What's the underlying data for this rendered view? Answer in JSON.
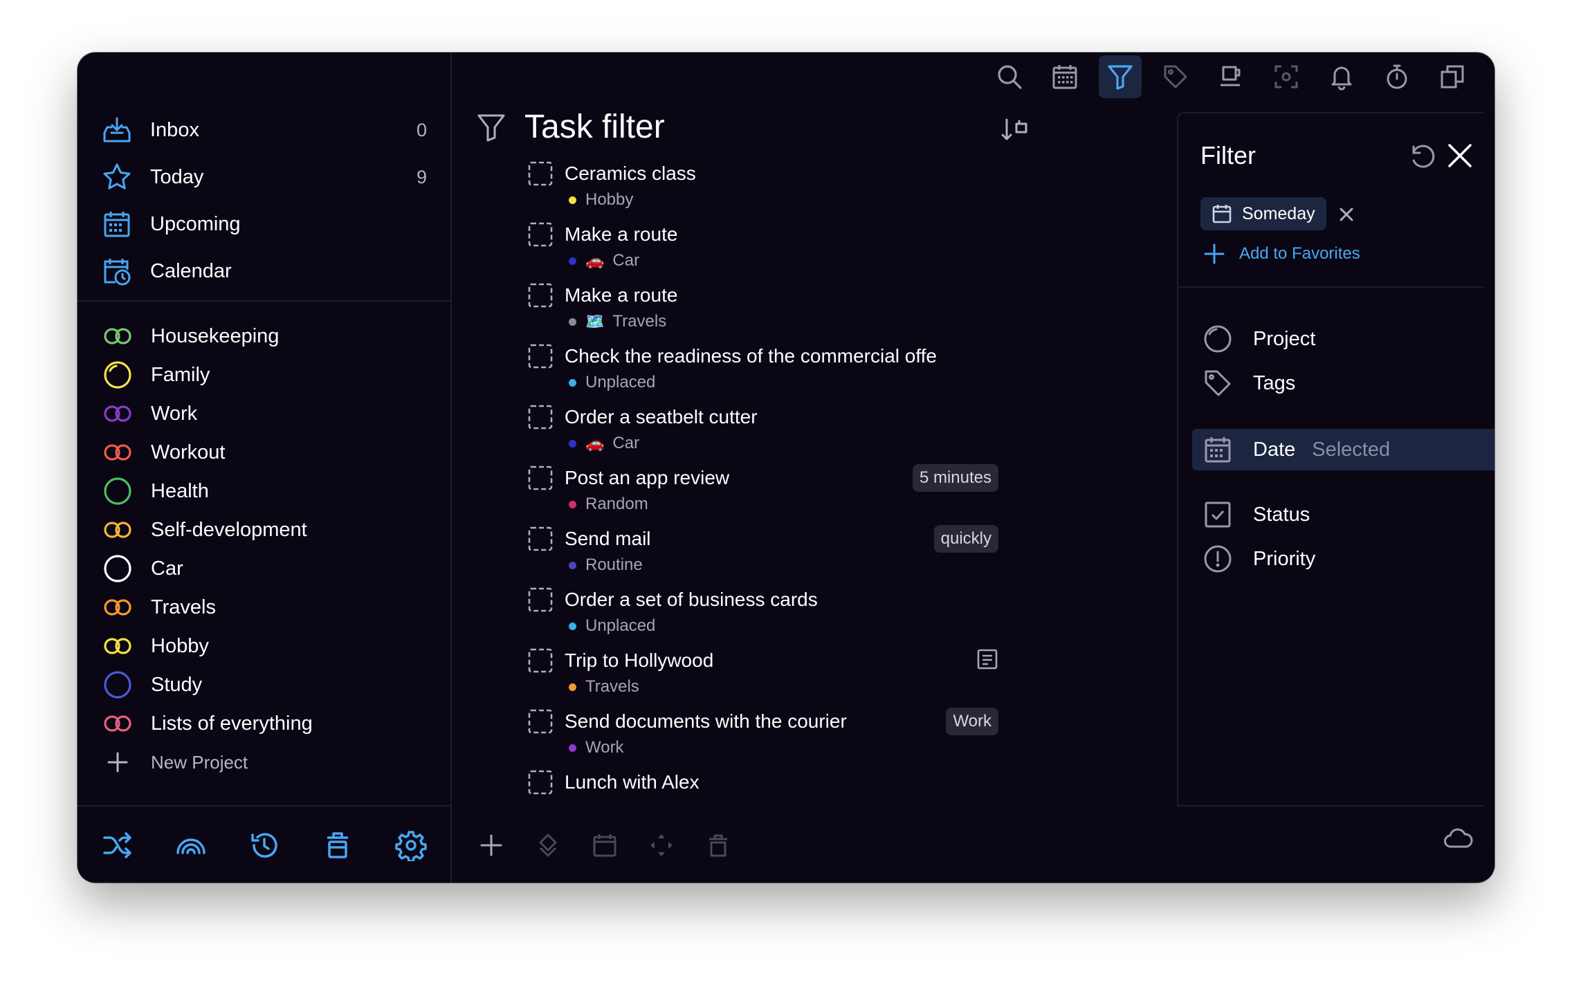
{
  "sidebar": {
    "nav": [
      {
        "label": "Inbox",
        "count": "0",
        "icon": "inbox-icon"
      },
      {
        "label": "Today",
        "count": "9",
        "icon": "star-icon"
      },
      {
        "label": "Upcoming",
        "count": "",
        "icon": "calendar-grid-icon"
      },
      {
        "label": "Calendar",
        "count": "",
        "icon": "calendar-clock-icon"
      }
    ],
    "projects": [
      {
        "label": "Housekeeping",
        "color": "#7ac86c",
        "shape": "double"
      },
      {
        "label": "Family",
        "color": "#f5e04a",
        "shape": "spinner"
      },
      {
        "label": "Work",
        "color": "#8a3cc8",
        "shape": "double"
      },
      {
        "label": "Workout",
        "color": "#f05a48",
        "shape": "double"
      },
      {
        "label": "Health",
        "color": "#4cc060",
        "shape": "circle"
      },
      {
        "label": "Self-development",
        "color": "#f4b43a",
        "shape": "double"
      },
      {
        "label": "Car",
        "color": "#ffffff",
        "shape": "circle"
      },
      {
        "label": "Travels",
        "color": "#f59a30",
        "shape": "double"
      },
      {
        "label": "Hobby",
        "color": "#f5e040",
        "shape": "double"
      },
      {
        "label": "Study",
        "color": "#4a5ad8",
        "shape": "circle"
      },
      {
        "label": "Lists of everything",
        "color": "#e8607a",
        "shape": "double"
      }
    ],
    "new_project_label": "New Project"
  },
  "main": {
    "title": "Task filter",
    "tasks": [
      {
        "name": "Ceramics class",
        "project": "Hobby",
        "dot": "#f5e040",
        "emoji": "",
        "badge": "",
        "note": false
      },
      {
        "name": "Make a route",
        "project": "Car",
        "dot": "#2a34c8",
        "emoji": "🚗",
        "badge": "",
        "note": false
      },
      {
        "name": "Make a route",
        "project": "Travels",
        "dot": "#8a8898",
        "emoji": "🗺️",
        "badge": "",
        "note": false
      },
      {
        "name": "Check the readiness of the commercial offe",
        "project": "Unplaced",
        "dot": "#3ab0e8",
        "emoji": "",
        "badge": "",
        "note": false
      },
      {
        "name": "Order a seatbelt cutter",
        "project": "Car",
        "dot": "#2a34c8",
        "emoji": "🚗",
        "badge": "",
        "note": false
      },
      {
        "name": "Post an app review",
        "project": "Random",
        "dot": "#d0306a",
        "emoji": "",
        "badge": "5 minutes",
        "note": false
      },
      {
        "name": "Send mail",
        "project": "Routine",
        "dot": "#4a48b8",
        "emoji": "",
        "badge": "quickly",
        "note": false
      },
      {
        "name": "Order a set of business cards",
        "project": "Unplaced",
        "dot": "#3ab0e8",
        "emoji": "",
        "badge": "",
        "note": false
      },
      {
        "name": "Trip to Hollywood",
        "project": "Travels",
        "dot": "#f59a30",
        "emoji": "",
        "badge": "",
        "note": true
      },
      {
        "name": "Send documents with the courier",
        "project": "Work",
        "dot": "#8a3cc8",
        "emoji": "",
        "badge": "Work",
        "note": false
      },
      {
        "name": "Lunch with Alex",
        "project": "",
        "dot": "#8a8898",
        "emoji": "",
        "badge": "",
        "note": false
      }
    ]
  },
  "filter": {
    "title": "Filter",
    "chip_label": "Someday",
    "add_favorites_label": "Add to Favorites",
    "rows": [
      {
        "label": "Project",
        "sub": "",
        "icon": "project-circle-icon"
      },
      {
        "label": "Tags",
        "sub": "",
        "icon": "tag-icon"
      },
      {
        "label": "Date",
        "sub": "Selected",
        "icon": "calendar-grid-icon"
      },
      {
        "label": "Status",
        "sub": "",
        "icon": "checkbox-icon"
      },
      {
        "label": "Priority",
        "sub": "",
        "icon": "exclamation-circle-icon"
      }
    ]
  },
  "colors": {
    "accent": "#48a6f4",
    "background": "#0a0614",
    "selected": "#1c2640"
  }
}
